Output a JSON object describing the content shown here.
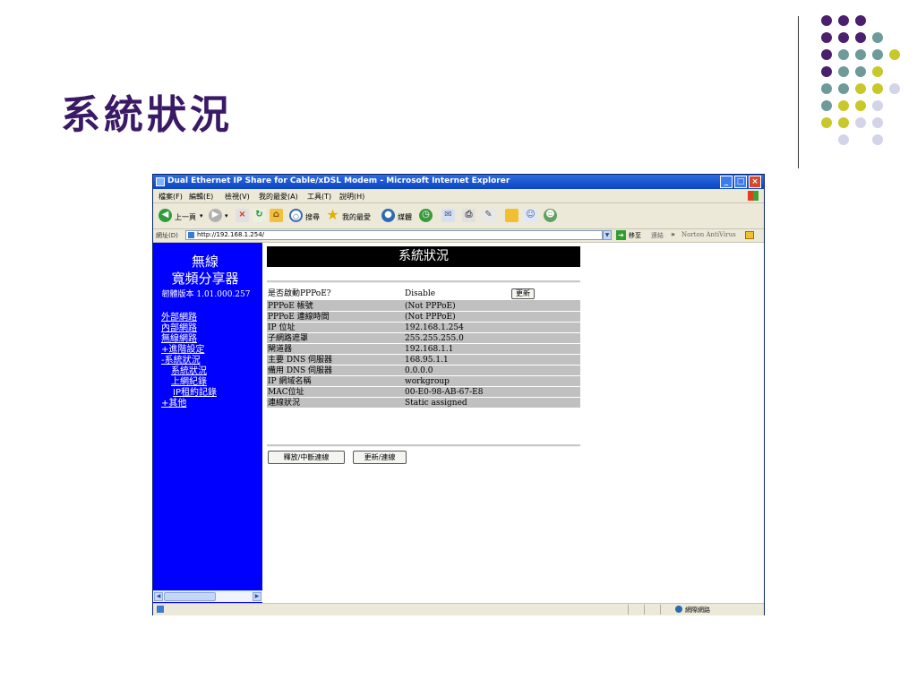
{
  "slide": {
    "title": "系統狀況",
    "dot_colors": {
      "purple": "#4a1f6e",
      "teal": "#6e9a9a",
      "olive": "#c8c82a",
      "lavender": "#d4d4e8"
    }
  },
  "browser": {
    "window_title": "Dual Ethernet IP Share for Cable/xDSL Modem - Microsoft Internet Explorer",
    "menus": [
      "檔案(F)",
      "編輯(E)",
      "檢視(V)",
      "我的最愛(A)",
      "工具(T)",
      "說明(H)"
    ],
    "toolbar": {
      "back": "上一頁",
      "search": "搜尋",
      "favorites": "我的最愛",
      "media": "媒體"
    },
    "address_label": "網址(D)",
    "url": "http://192.168.1.254/",
    "go_label": "移至",
    "links_label": "連結",
    "norton_label": "Norton AntiVirus",
    "status_zone": "網際網路"
  },
  "sidebar": {
    "title_line1": "無線",
    "title_line2": "寬頻分享器",
    "firmware": "韌體版本 1.01.000.257",
    "nav": [
      "外部網路",
      "內部網路",
      "無線網路",
      "+進階設定",
      "-系統狀況",
      "系統狀況",
      "上網紀錄",
      "IP租約記錄",
      "+其他"
    ]
  },
  "page": {
    "heading": "系統狀況",
    "refresh_label": "更新",
    "rows": [
      {
        "label": "是否啟動PPPoE?",
        "value": "Disable"
      },
      {
        "label": "PPPoE 帳號",
        "value": "(Not PPPoE)"
      },
      {
        "label": "PPPoE 連線時間",
        "value": "(Not PPPoE)"
      },
      {
        "label": "IP 位址",
        "value": "192.168.1.254"
      },
      {
        "label": "子網路遮罩",
        "value": "255.255.255.0"
      },
      {
        "label": "閘道器",
        "value": "192.168.1.1"
      },
      {
        "label": "主要 DNS 伺服器",
        "value": "168.95.1.1"
      },
      {
        "label": "備用 DNS 伺服器",
        "value": "0.0.0.0"
      },
      {
        "label": "IP 網域名稱",
        "value": "workgroup"
      },
      {
        "label": "MAC位址",
        "value": "00-E0-98-AB-67-E8"
      },
      {
        "label": "連線狀況",
        "value": "Static assigned"
      }
    ],
    "release_label": "釋放/中斷連線",
    "renew_label": "更新/連線"
  }
}
